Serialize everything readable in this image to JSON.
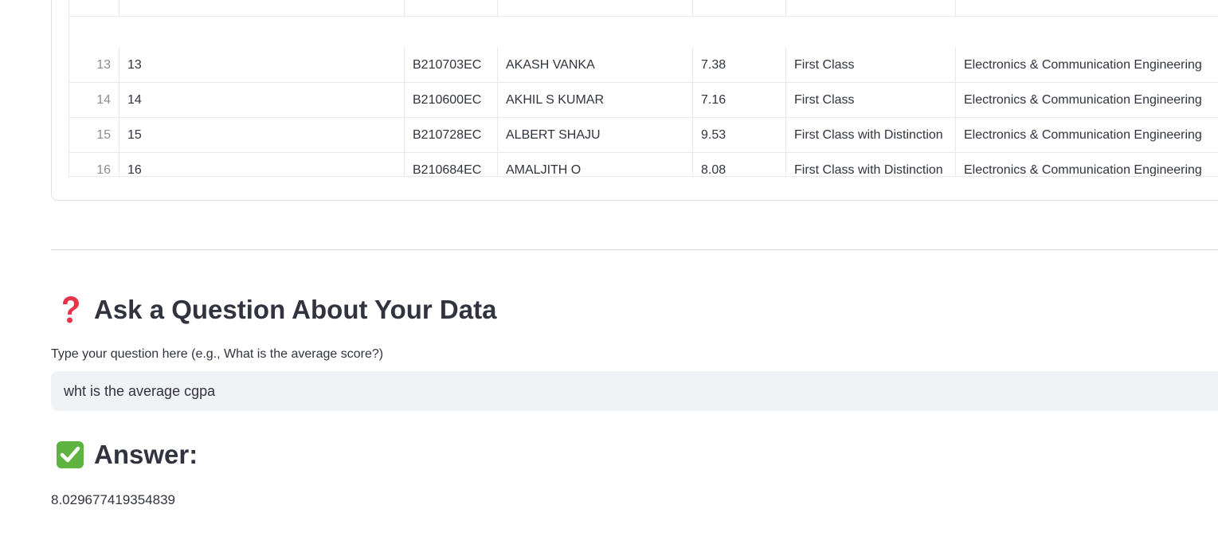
{
  "table": {
    "rows": [
      {
        "index": "",
        "c1": "",
        "c2": "",
        "c3": "",
        "c4": "",
        "c5": "",
        "c6": ""
      },
      {
        "index": "13",
        "c1": "13",
        "c2": "B210703EC",
        "c3": "AKASH VANKA",
        "c4": "7.38",
        "c5": "First Class",
        "c6": "Electronics & Communication  Engineering"
      },
      {
        "index": "14",
        "c1": "14",
        "c2": "B210600EC",
        "c3": "AKHIL S KUMAR",
        "c4": "7.16",
        "c5": "First Class",
        "c6": "Electronics & Communication  Engineering"
      },
      {
        "index": "15",
        "c1": "15",
        "c2": "B210728EC",
        "c3": "ALBERT SHAJU",
        "c4": "9.53",
        "c5": "First Class with Distinction",
        "c6": "Electronics & Communication  Engineering"
      },
      {
        "index": "16",
        "c1": "16",
        "c2": "B210684EC",
        "c3": "AMALJITH O",
        "c4": "8.08",
        "c5": "First Class with Distinction",
        "c6": "Electronics & Communication  Engineering"
      }
    ]
  },
  "question_section": {
    "heading": "Ask a Question About Your Data",
    "icon": "question-mark-icon",
    "label": "Type your question here (e.g., What is the average score?)",
    "input_value": "wht is the average cgpa"
  },
  "answer_section": {
    "heading": "Answer:",
    "icon": "check-mark-icon",
    "value": "8.029677419354839"
  },
  "colors": {
    "input_bg": "#f0f2f6",
    "text": "#31333f",
    "question_icon": "#e8334a",
    "check_icon": "#5fb340"
  }
}
